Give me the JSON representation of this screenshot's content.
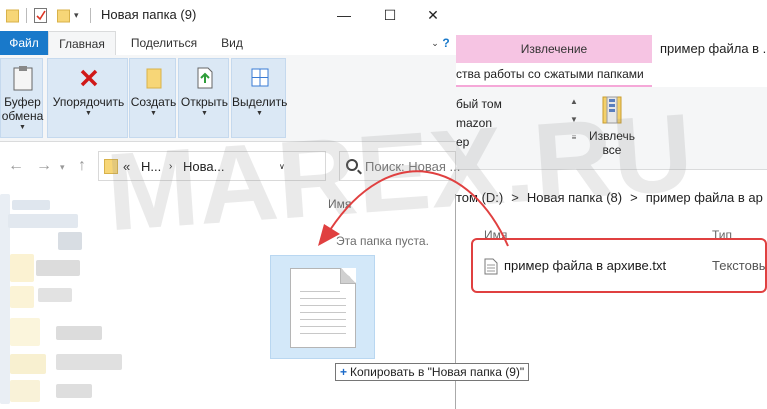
{
  "front_window": {
    "title": "Новая папка (9)",
    "tabs": {
      "file": "Файл",
      "home": "Главная",
      "share": "Поделиться",
      "view": "Вид"
    },
    "ribbon": {
      "clipboard": "Буфер обмена",
      "organize": "Упорядочить",
      "new": "Создать",
      "open": "Открыть",
      "select": "Выделить"
    },
    "address": {
      "chevron": "«",
      "part1": "Н...",
      "part2": "Нова..."
    },
    "search_placeholder": "Поиск: Новая ...",
    "column_name": "Имя",
    "empty_message": "Эта папка пуста.",
    "drag_tooltip": "Копировать в \"Новая папка (9)\""
  },
  "back_window": {
    "extract_tab": "Извлечение",
    "title": "пример файла в ...",
    "zip_tools_label": "ства работы со сжатыми папками",
    "destinations": [
      "бый том",
      "mazon",
      "ер"
    ],
    "extract_all": "Извлечь все",
    "breadcrumb": [
      "том (D:)",
      ">",
      "Новая папка (8)",
      ">",
      "пример файла в ар"
    ],
    "column_name": "Имя",
    "column_type": "Тип",
    "file_name": "пример файла в архиве.txt",
    "file_type": "Текстовы"
  },
  "watermark": "MAREX.RU",
  "colors": {
    "file_tab": "#1979ca",
    "extract_tab": "#f6c4e3",
    "highlight": "#e04040",
    "arrow": "#e04040",
    "ribbon_group": "#dbe8f5"
  }
}
